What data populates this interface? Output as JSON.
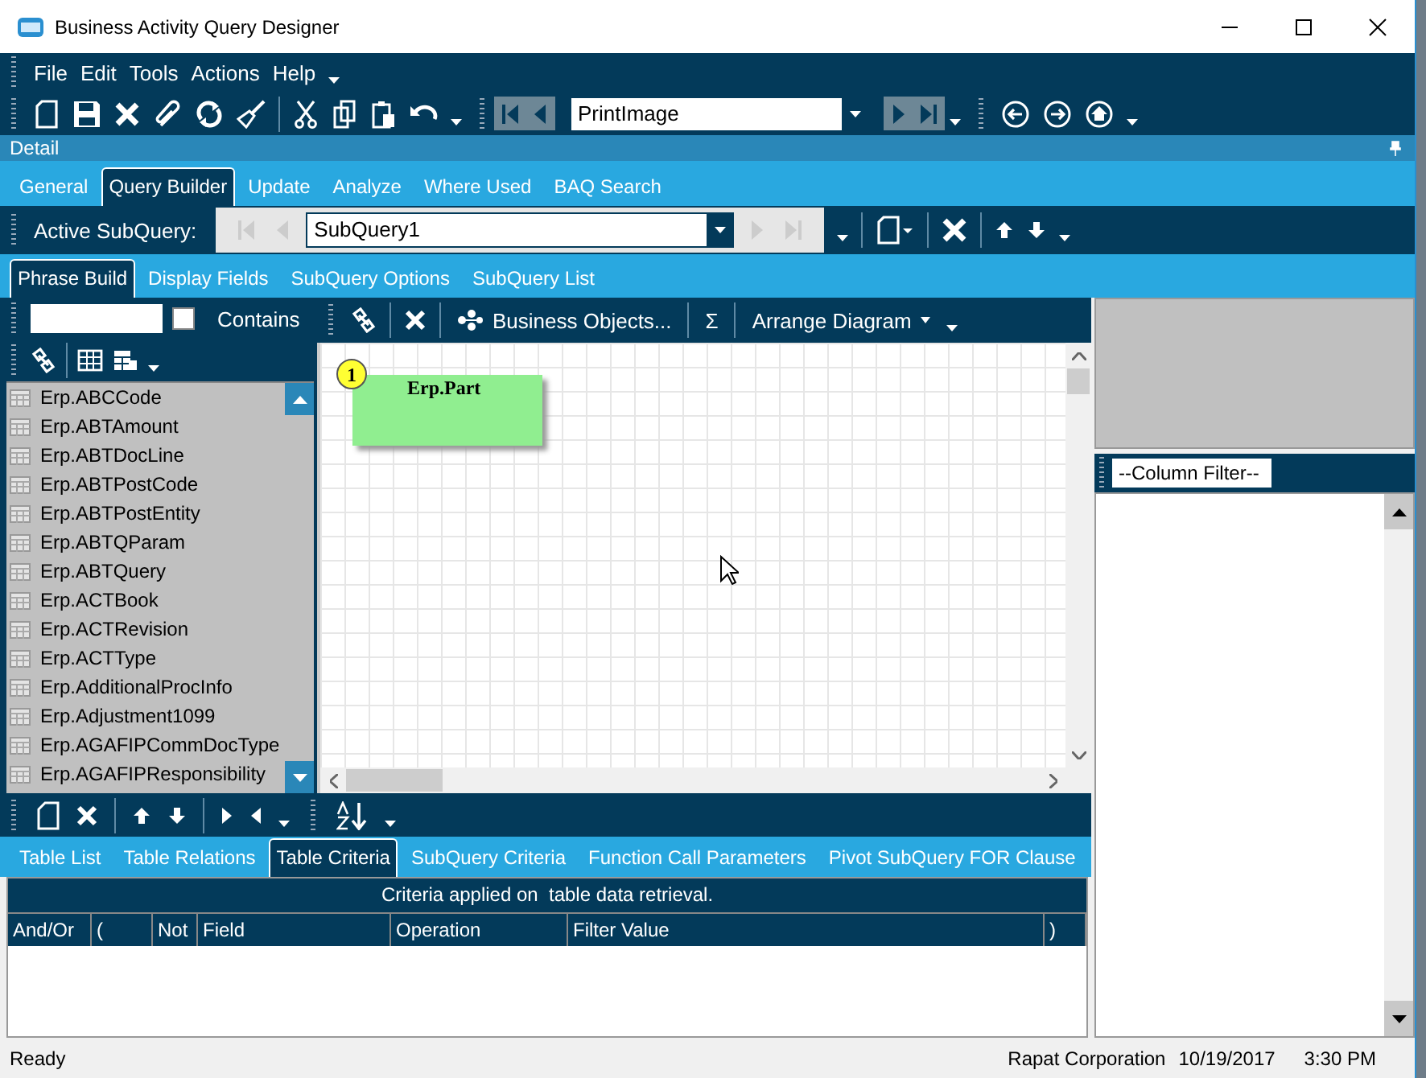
{
  "window": {
    "title": "Business Activity Query Designer"
  },
  "menu": [
    {
      "label": "File"
    },
    {
      "label": "Edit"
    },
    {
      "label": "Tools"
    },
    {
      "label": "Actions"
    },
    {
      "label": "Help"
    }
  ],
  "toolbar": {
    "print_combo": {
      "value": "PrintImage"
    }
  },
  "detail_bar": {
    "title": "Detail"
  },
  "tabs": [
    {
      "label": "General",
      "selected": false
    },
    {
      "label": "Query Builder",
      "selected": true
    },
    {
      "label": "Update",
      "selected": false
    },
    {
      "label": "Analyze",
      "selected": false
    },
    {
      "label": "Where Used",
      "selected": false
    },
    {
      "label": "BAQ Search",
      "selected": false
    }
  ],
  "subquery": {
    "label": "Active SubQuery:",
    "value": "SubQuery1"
  },
  "subtabs": [
    {
      "label": "Phrase Build",
      "selected": true
    },
    {
      "label": "Display Fields",
      "selected": false
    },
    {
      "label": "SubQuery Options",
      "selected": false
    },
    {
      "label": "SubQuery List",
      "selected": false
    }
  ],
  "left_panel": {
    "contains": {
      "label": "Contains",
      "checked": false
    },
    "tables": [
      "Erp.ABCCode",
      "Erp.ABTAmount",
      "Erp.ABTDocLine",
      "Erp.ABTPostCode",
      "Erp.ABTPostEntity",
      "Erp.ABTQParam",
      "Erp.ABTQuery",
      "Erp.ACTBook",
      "Erp.ACTRevision",
      "Erp.ACTType",
      "Erp.AdditionalProcInfo",
      "Erp.Adjustment1099",
      "Erp.AGAFIPCommDocType",
      "Erp.AGAFIPResponsibility"
    ]
  },
  "diagram_toolbar": {
    "business_objects": "Business Objects...",
    "sum": "Σ",
    "arrange": "Arrange Diagram"
  },
  "diagram": {
    "nodes": [
      {
        "number": "1",
        "name": "Erp.Part"
      }
    ]
  },
  "column_filter": {
    "value": "--Column Filter--"
  },
  "bottom_tabs": [
    {
      "label": "Table List",
      "selected": false
    },
    {
      "label": "Table Relations",
      "selected": false
    },
    {
      "label": "Table Criteria",
      "selected": true
    },
    {
      "label": "SubQuery Criteria",
      "selected": false
    },
    {
      "label": "Function Call Parameters",
      "selected": false
    },
    {
      "label": "Pivot SubQuery FOR Clause",
      "selected": false
    }
  ],
  "criteria": {
    "caption": "Criteria applied on  table data retrieval.",
    "columns": [
      "And/Or",
      "(",
      "Not",
      "Field",
      "Operation",
      "Filter Value",
      ")"
    ]
  },
  "status_bar": {
    "left": "Ready",
    "company": "Rapat Corporation",
    "date": "10/19/2017",
    "time": "3:30 PM"
  }
}
